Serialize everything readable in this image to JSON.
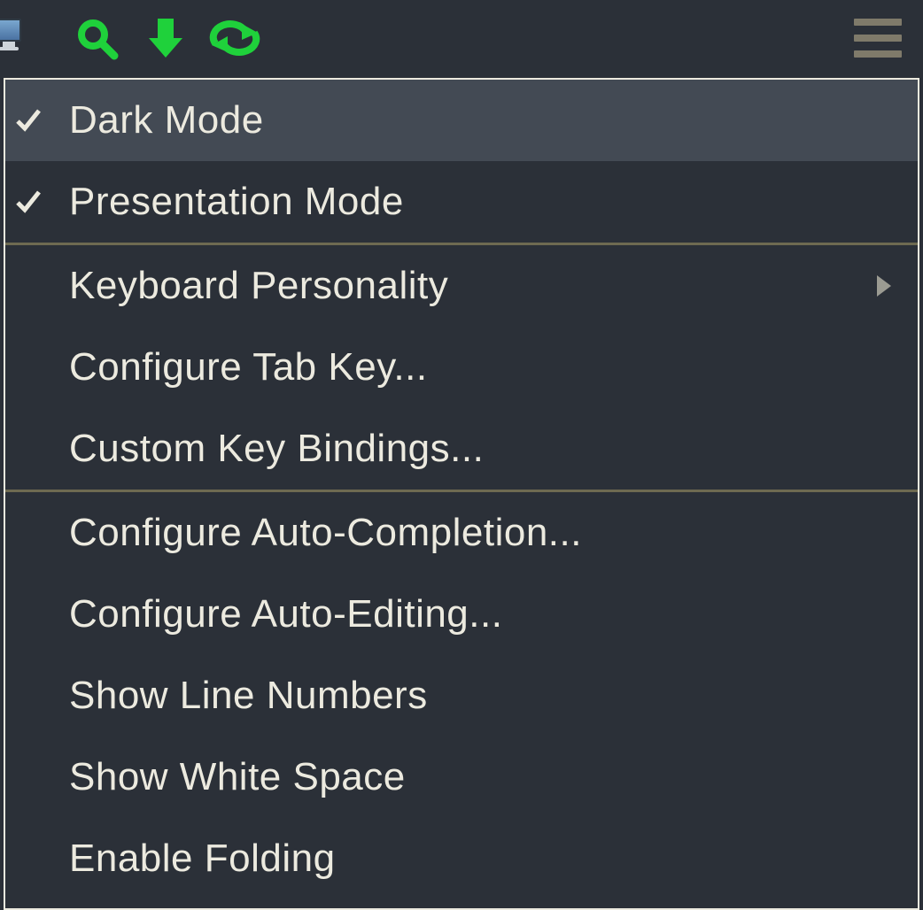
{
  "toolbar": {
    "icons": [
      "monitor-icon",
      "search-icon",
      "download-icon",
      "refresh-icon",
      "hamburger-icon"
    ]
  },
  "menu": {
    "items": [
      {
        "label": "Dark Mode",
        "checked": true,
        "submenu": false,
        "highlight": true
      },
      {
        "label": "Presentation Mode",
        "checked": true,
        "submenu": false,
        "highlight": false
      },
      {
        "separator": true
      },
      {
        "label": "Keyboard Personality",
        "checked": false,
        "submenu": true,
        "highlight": false
      },
      {
        "label": "Configure Tab Key...",
        "checked": false,
        "submenu": false,
        "highlight": false
      },
      {
        "label": "Custom Key Bindings...",
        "checked": false,
        "submenu": false,
        "highlight": false
      },
      {
        "separator": true
      },
      {
        "label": "Configure Auto-Completion...",
        "checked": false,
        "submenu": false,
        "highlight": false
      },
      {
        "label": "Configure Auto-Editing...",
        "checked": false,
        "submenu": false,
        "highlight": false
      },
      {
        "label": "Show Line Numbers",
        "checked": false,
        "submenu": false,
        "highlight": false
      },
      {
        "label": "Show White Space",
        "checked": false,
        "submenu": false,
        "highlight": false
      },
      {
        "label": "Enable Folding",
        "checked": false,
        "submenu": false,
        "highlight": false
      }
    ]
  },
  "colors": {
    "accent": "#1fd13b",
    "text": "#eceadf",
    "bg": "#2b3038",
    "highlight": "#434a54",
    "separator": "#6e6a51"
  }
}
